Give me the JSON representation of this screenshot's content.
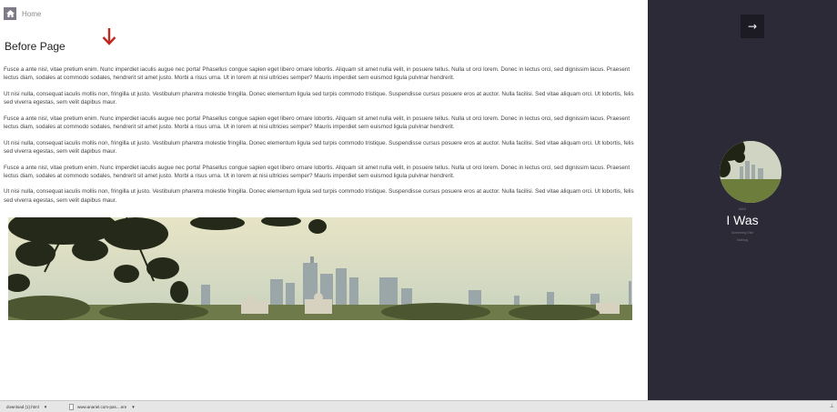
{
  "breadcrumb": {
    "home_label": "Home"
  },
  "page": {
    "title": "Before Page"
  },
  "paragraphs": [
    "Fusce a ante nisl, vitae pretium enim. Nunc imperdiet iaculis augue nec porta! Phasellus congue sapien eget libero ornare lobortis. Aliquam sit amet nulla velit, in posuere tellus. Nulla ut orci lorem. Donec in lectus orci, sed dignissim lacus. Praesent lectus diam, sodales at commodo sodales, hendrerit sit amet justo. Morbi a risus urna. Ut in lorem at nisi ultricies semper? Mauris imperdiet sem euismod ligula pulvinar hendrerit.",
    "Ut nisi nulla, consequat iaculis mollis non, fringilla ut justo. Vestibulum pharetra molestie fringilla. Donec elementum ligula sed turpis commodo tristique. Suspendisse cursus posuere eros at auctor. Nulla facilisi. Sed vitae aliquam orci. Ut lobortis, felis sed viverra egestas, sem velit dapibus maur.",
    "Fusce a ante nisl, vitae pretium enim. Nunc imperdiet iaculis augue nec porta! Phasellus congue sapien eget libero ornare lobortis. Aliquam sit amet nulla velit, in posuere tellus. Nulla ut orci lorem. Donec in lectus orci, sed dignissim lacus. Praesent lectus diam, sodales at commodo sodales, hendrerit sit amet justo. Morbi a risus urna. Ut in lorem at nisi ultricies semper? Mauris imperdiet sem euismod ligula pulvinar hendrerit.",
    "Ut nisi nulla, consequat iaculis mollis non, fringilla ut justo. Vestibulum pharetra molestie fringilla. Donec elementum ligula sed turpis commodo tristique. Suspendisse cursus posuere eros at auctor. Nulla facilisi. Sed vitae aliquam orci. Ut lobortis, felis sed viverra egestas, sem velit dapibus maur.",
    "Fusce a ante nisl, vitae pretium enim. Nunc imperdiet iaculis augue nec porta! Phasellus congue sapien eget libero ornare lobortis. Aliquam sit amet nulla velit, in posuere tellus. Nulla ut orci lorem. Donec in lectus orci, sed dignissim lacus. Praesent lectus diam, sodales at commodo sodales, hendrerit sit amet justo. Morbi a risus urna. Ut in lorem at nisi ultricies semper? Mauris imperdiet sem euismod ligula pulvinar hendrerit.",
    "Ut nisi nulla, consequat iaculis mollis non, fringilla ut justo. Vestibulum pharetra molestie fringilla. Donec elementum ligula sed turpis commodo tristique. Suspendisse cursus posuere eros at auctor. Nulla facilisi. Sed vitae aliquam orci. Ut lobortis, felis sed viverra egestas, sem velit dapibus maur."
  ],
  "sidebar": {
    "next_icon": "→",
    "name": "I Was",
    "label_above": "WAS",
    "label_below_1": "Something Else",
    "label_below_2": "Nothing"
  },
  "downloads": [
    {
      "name": "download (1).html"
    },
    {
      "name": "www.anariel.com-pas....ere"
    }
  ],
  "icons": {
    "home": "home-icon",
    "next": "right-arrow-icon",
    "scroll_hint": "down-arrow-icon",
    "tray": "pin-icon"
  },
  "colors": {
    "sidebar_bg": "#2b2a36",
    "accent_red": "#c0281f",
    "home_btn": "#7e7b86"
  }
}
